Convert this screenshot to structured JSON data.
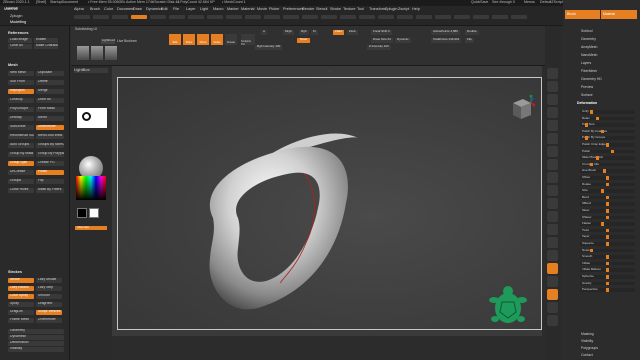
{
  "titlebar": {
    "app": "ZBrush 2020.1.1",
    "doc": "[Shelf]",
    "doc2": "StartupDocument",
    "free_mem": "• Free Mem 55.006GB",
    "active_mem": "• Active Mem 1744",
    "scratch": "• Scratch Disk 48",
    "poly": "• PolyCount 42.664 KP",
    "mesh": "• MeshCount 1",
    "quicksave": "QuickSave",
    "seethrough": "See-through  0",
    "menus": "Menus",
    "script": "DefaultZScript"
  },
  "menubar": {
    "items": [
      "Alpha",
      "Brush",
      "Color",
      "Document",
      "Draw",
      "Dynamics",
      "Edit",
      "File",
      "Layer",
      "Light",
      "Macro",
      "Marker",
      "Material",
      "Movie",
      "Picker",
      "Preferences",
      "Render",
      "Stencil",
      "Stroke",
      "Texture",
      "Tool",
      "Transform",
      "Zplugin",
      "Zscript",
      "Help"
    ]
  },
  "left_panel": {
    "tabs": [
      "Material",
      "Zplugin",
      "Modelling"
    ],
    "references": "References",
    "refs_buttons": [
      "Load Image",
      "Rotate",
      "Clear All",
      "Make Character Sheet"
    ],
    "mesh_head": "Mesh",
    "mesh_buttons": [
      "New Mesh",
      "Duplicate",
      "Sub From",
      "Delete",
      "Reproject",
      "Merge",
      "Cleanup",
      "Done All",
      "PolyGroupIt",
      "From Mask",
      "Unwrap",
      "Mirror",
      "SubDivide",
      "ZRemesher",
      "Reconstruct Subdiv",
      "Mirror And Weld",
      "Auto Groups",
      "Groups By Normals",
      "Group By Mask",
      "Group By Polypaint",
      "Group Split",
      "Crease PG",
      "UnCrease",
      "Polish",
      "Groups",
      "Flip",
      "Close Holes",
      "Mask By Fibers"
    ],
    "bottom_head": "Strokes",
    "bottom_buttons": [
      "Stroke",
      "Lazy Mouse",
      "Lazy Radius",
      "Lazy Step",
      "Color Spray",
      "Smooth",
      "Spray",
      "DragRect",
      "DragDot",
      "Sculpt Vertices",
      "Frame Mesh",
      "ZRemesher"
    ],
    "bottom_labels": [
      "Geometry",
      "Dynamesh",
      "Deformation",
      "Visibility"
    ]
  },
  "shelf": {
    "row1": [
      "Edit",
      "Draw",
      "Move",
      "Scale",
      "Rotate",
      "Sculptris Pro"
    ],
    "labels": [
      "Subdividing UI",
      "Live Boolean",
      "A",
      "Mrgb",
      "Rgb",
      "M",
      "Zadd",
      "Zsub",
      "Focal Shift 0",
      "Draw Size 64",
      "Dynamic",
      "Z Intensity 100",
      "Rgb Intensity 100",
      "ActivePoints 4,680",
      "TotalPoints 446,901",
      "Double",
      "Flip"
    ],
    "draw_label": "Draw",
    "tabs": [
      "LightBox",
      "Lightbox2"
    ]
  },
  "tool_strip": {
    "items": [
      "Brush",
      "Standard",
      "Alpha Off",
      "Texture Off",
      "MatCap Gray",
      "Gradient",
      "SwitchColor",
      "Alternate"
    ]
  },
  "right_panel": {
    "tabs": [
      "Brush",
      "Material"
    ],
    "head": "Deformation",
    "sections": [
      "Subtool",
      "Geometry",
      "ArrayMesh",
      "NanoMesh",
      "Layers",
      "FiberMesh",
      "Geometry HD",
      "Preview",
      "Surface"
    ],
    "sliders": [
      {
        "name": "Unify",
        "val": 0.2
      },
      {
        "name": "Relax",
        "val": 0.3
      },
      {
        "name": "Poly Size",
        "val": 0.1
      },
      {
        "name": "Polish By Features",
        "val": 0.4
      },
      {
        "name": "Polish By Groups",
        "val": 0.1
      },
      {
        "name": "Polish Crisp Edges",
        "val": 0.5
      },
      {
        "name": "Polish",
        "val": 0.6
      },
      {
        "name": "Slide Plane Exit",
        "val": 0.3
      },
      {
        "name": "Crumple Idle",
        "val": 0.2
      },
      {
        "name": "Hue Brush",
        "val": 0.45
      },
      {
        "name": "Offset",
        "val": 0.5
      },
      {
        "name": "Rotate",
        "val": 0.5
      },
      {
        "name": "Size",
        "val": 0.4
      },
      {
        "name": "Bend",
        "val": 0.5
      },
      {
        "name": "SBend",
        "val": 0.5
      },
      {
        "name": "Skew",
        "val": 0.5
      },
      {
        "name": "SSkew",
        "val": 0.5
      },
      {
        "name": "Flatten",
        "val": 0.4
      },
      {
        "name": "Twist",
        "val": 0.5
      },
      {
        "name": "Taper",
        "val": 0.5
      },
      {
        "name": "Squeeze",
        "val": 0.5
      },
      {
        "name": "Noise",
        "val": 0.2
      },
      {
        "name": "Smooth",
        "val": 0.5
      },
      {
        "name": "Inflate",
        "val": 0.5
      },
      {
        "name": "Inflate Balloon",
        "val": 0.5
      },
      {
        "name": "Spherize",
        "val": 0.5
      },
      {
        "name": "Gravity",
        "val": 0.5
      },
      {
        "name": "Perspective",
        "val": 0.5
      }
    ],
    "bottom": [
      "Masking",
      "Visibility",
      "Polygroups",
      "Contact"
    ]
  },
  "right_strip": {
    "icons": [
      "Bpr",
      "SPix 3",
      "Scroll",
      "Zoom",
      "Actual",
      "AAHalf",
      "Persp",
      "Floor",
      "Local",
      "XYZ",
      "Frame",
      "Move",
      "Scale",
      "Rotate",
      "Line Fill",
      "PolyF",
      "Transp",
      "Ghost",
      "Solo",
      "Xpose"
    ]
  },
  "colors": {
    "accent": "#e67e22",
    "panel": "#2a2a2a",
    "viewport": "#3a3a3a"
  }
}
